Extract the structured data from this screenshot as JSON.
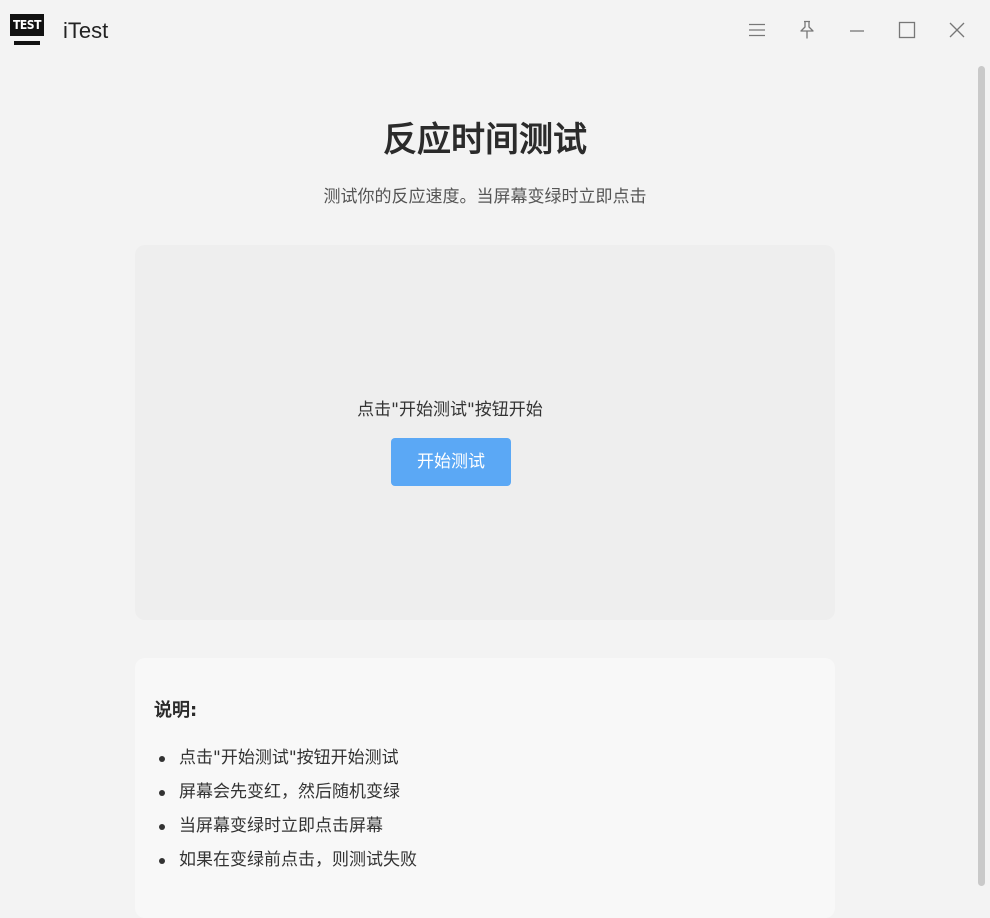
{
  "window": {
    "title": "iTest",
    "logo_text": "TEST",
    "controls": [
      "menu-icon",
      "pin-icon",
      "minimize-icon",
      "maximize-icon",
      "close-icon"
    ]
  },
  "page": {
    "title": "反应时间测试",
    "subtitle": "测试你的反应速度。当屏幕变绿时立即点击"
  },
  "test_area": {
    "prompt": "点击\"开始测试\"按钮开始",
    "start_label": "开始测试"
  },
  "instructions": {
    "heading": "说明:",
    "items": [
      "点击\"开始测试\"按钮开始测试",
      "屏幕会先变红，然后随机变绿",
      "当屏幕变绿时立即点击屏幕",
      "如果在变绿前点击，则测试失败"
    ]
  },
  "colors": {
    "button": "#5ba8f5",
    "background": "#f3f3f3",
    "test_area": "#eeeeee"
  }
}
